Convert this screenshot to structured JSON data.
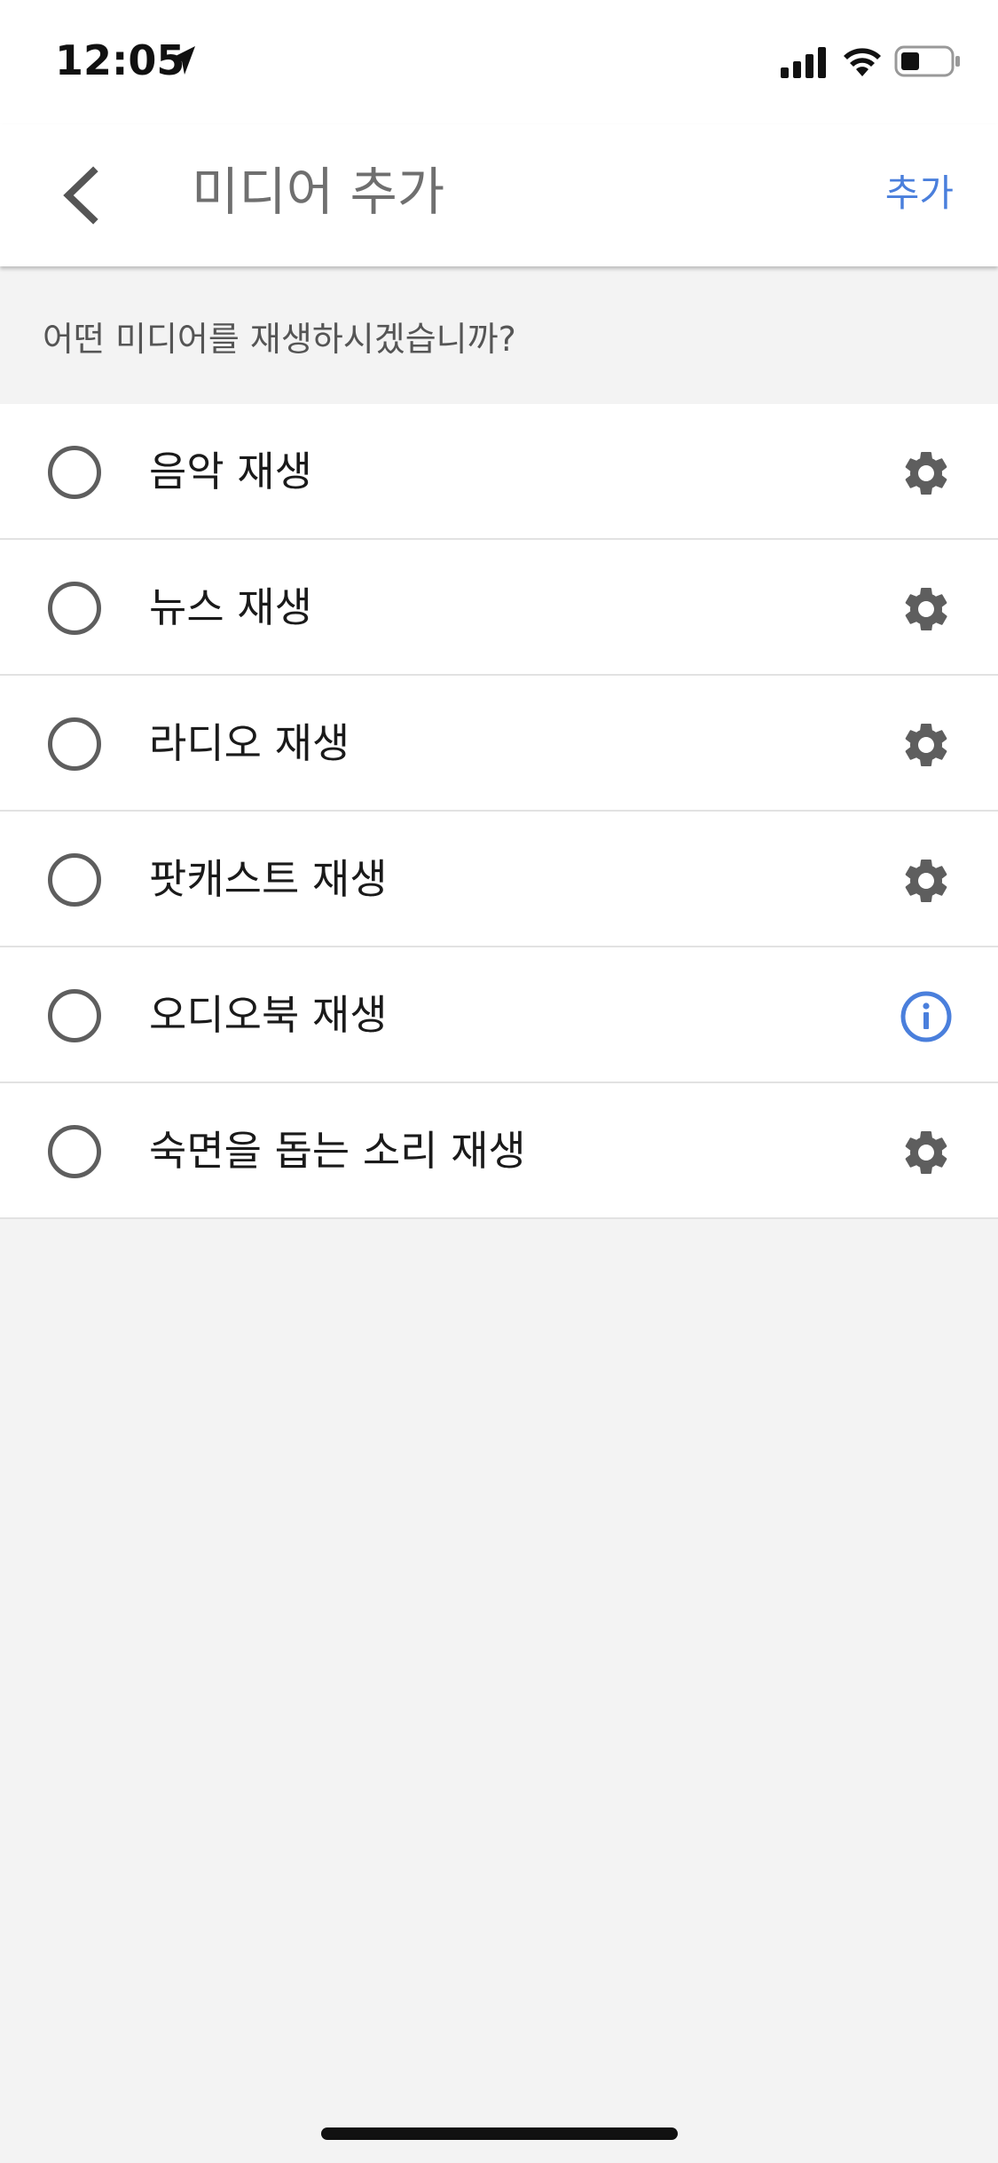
{
  "status_bar": {
    "time": "12:05",
    "location_icon": "location-arrow-icon",
    "signal_icon": "cellular-signal-icon",
    "wifi_icon": "wifi-icon",
    "battery_icon": "battery-icon"
  },
  "header": {
    "back_icon": "chevron-left-icon",
    "title": "미디어 추가",
    "action_label": "추가"
  },
  "question": "어떤 미디어를 재생하시겠습니까?",
  "items": [
    {
      "label": "음악 재생",
      "icon": "gear-icon"
    },
    {
      "label": "뉴스 재생",
      "icon": "gear-icon"
    },
    {
      "label": "라디오 재생",
      "icon": "gear-icon"
    },
    {
      "label": "팟캐스트 재생",
      "icon": "gear-icon"
    },
    {
      "label": "오디오북 재생",
      "icon": "info-icon"
    },
    {
      "label": "숙면을 돕는 소리 재생",
      "icon": "gear-icon"
    }
  ],
  "colors": {
    "accent": "#4a7fdc",
    "background": "#f3f3f3",
    "gear": "#5e5e5e"
  }
}
